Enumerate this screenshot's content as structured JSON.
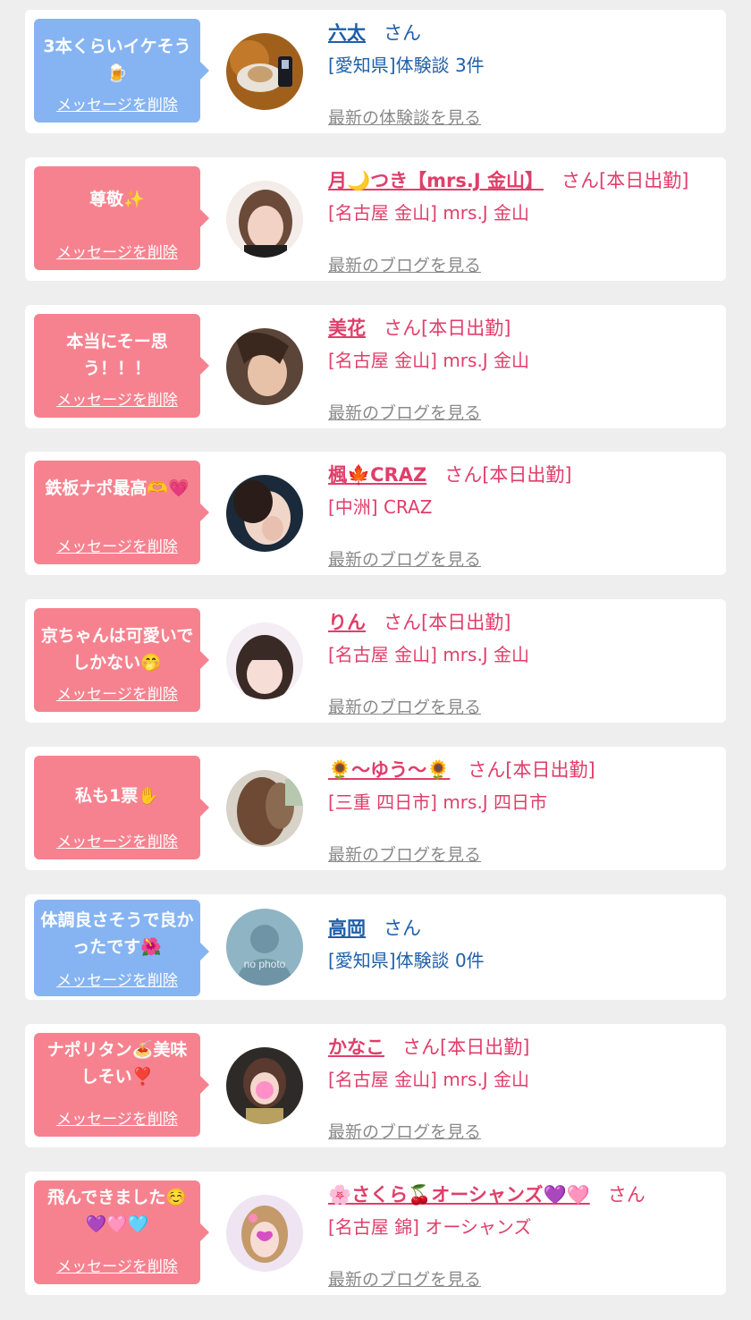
{
  "delete_label": "メッセージを削除",
  "colors": {
    "pink_bubble": "#f7828f",
    "blue_bubble": "#86b4f2",
    "pink_text": "#e03e6a",
    "blue_text": "#1f5fa8"
  },
  "items": [
    {
      "type": "reviewer",
      "message": "3本くらいイケそう🍺",
      "name": "六太",
      "suffix": "さん",
      "sub": "[愛知県]体験談 3件",
      "link": "最新の体験談を見る",
      "avatar": "food-photo"
    },
    {
      "type": "cast",
      "message": "尊敬✨",
      "name": "月🌙つき【mrs.J 金山】",
      "suffix": "さん[本日出勤]",
      "sub": "[名古屋 金山] mrs.J 金山",
      "link": "最新のブログを見る",
      "avatar": "woman-photo"
    },
    {
      "type": "cast",
      "message": "本当にそー思う！！！",
      "name": "美花",
      "suffix": "さん[本日出勤]",
      "sub": "[名古屋 金山] mrs.J 金山",
      "link": "最新のブログを見る",
      "avatar": "woman-photo"
    },
    {
      "type": "cast",
      "message": "鉄板ナポ最高🫶💗",
      "name": "楓🍁CRAZ",
      "suffix": "さん[本日出勤]",
      "sub": "[中洲] CRAZ",
      "link": "最新のブログを見る",
      "avatar": "woman-photo"
    },
    {
      "type": "cast",
      "message": "京ちゃんは可愛いでしかない🤭",
      "name": "りん",
      "suffix": "さん[本日出勤]",
      "sub": "[名古屋 金山] mrs.J 金山",
      "link": "最新のブログを見る",
      "avatar": "woman-photo"
    },
    {
      "type": "cast",
      "message": "私も1票✋",
      "name": "🌻〜ゆう〜🌻",
      "suffix": "さん[本日出勤]",
      "sub": "[三重 四日市] mrs.J 四日市",
      "link": "最新のブログを見る",
      "avatar": "woman-photo"
    },
    {
      "type": "reviewer",
      "message": "体調良さそうで良かったです🌺",
      "name": "高岡",
      "suffix": "さん",
      "sub": "[愛知県]体験談 0件",
      "link": "",
      "avatar": "no-photo",
      "avatar_text": "no photo"
    },
    {
      "type": "cast",
      "message": "ナポリタン🍝美味しそい❣️",
      "name": "かなこ",
      "suffix": "さん[本日出勤]",
      "sub": "[名古屋 金山] mrs.J 金山",
      "link": "最新のブログを見る",
      "avatar": "woman-photo"
    },
    {
      "type": "cast",
      "message": "飛んできました☺️💜🩷🩵",
      "name": "🌸さくら🍒オーシャンズ💜🩷",
      "suffix": "さん",
      "sub": "[名古屋 錦] オーシャンズ",
      "link": "最新のブログを見る",
      "avatar": "woman-photo"
    }
  ]
}
